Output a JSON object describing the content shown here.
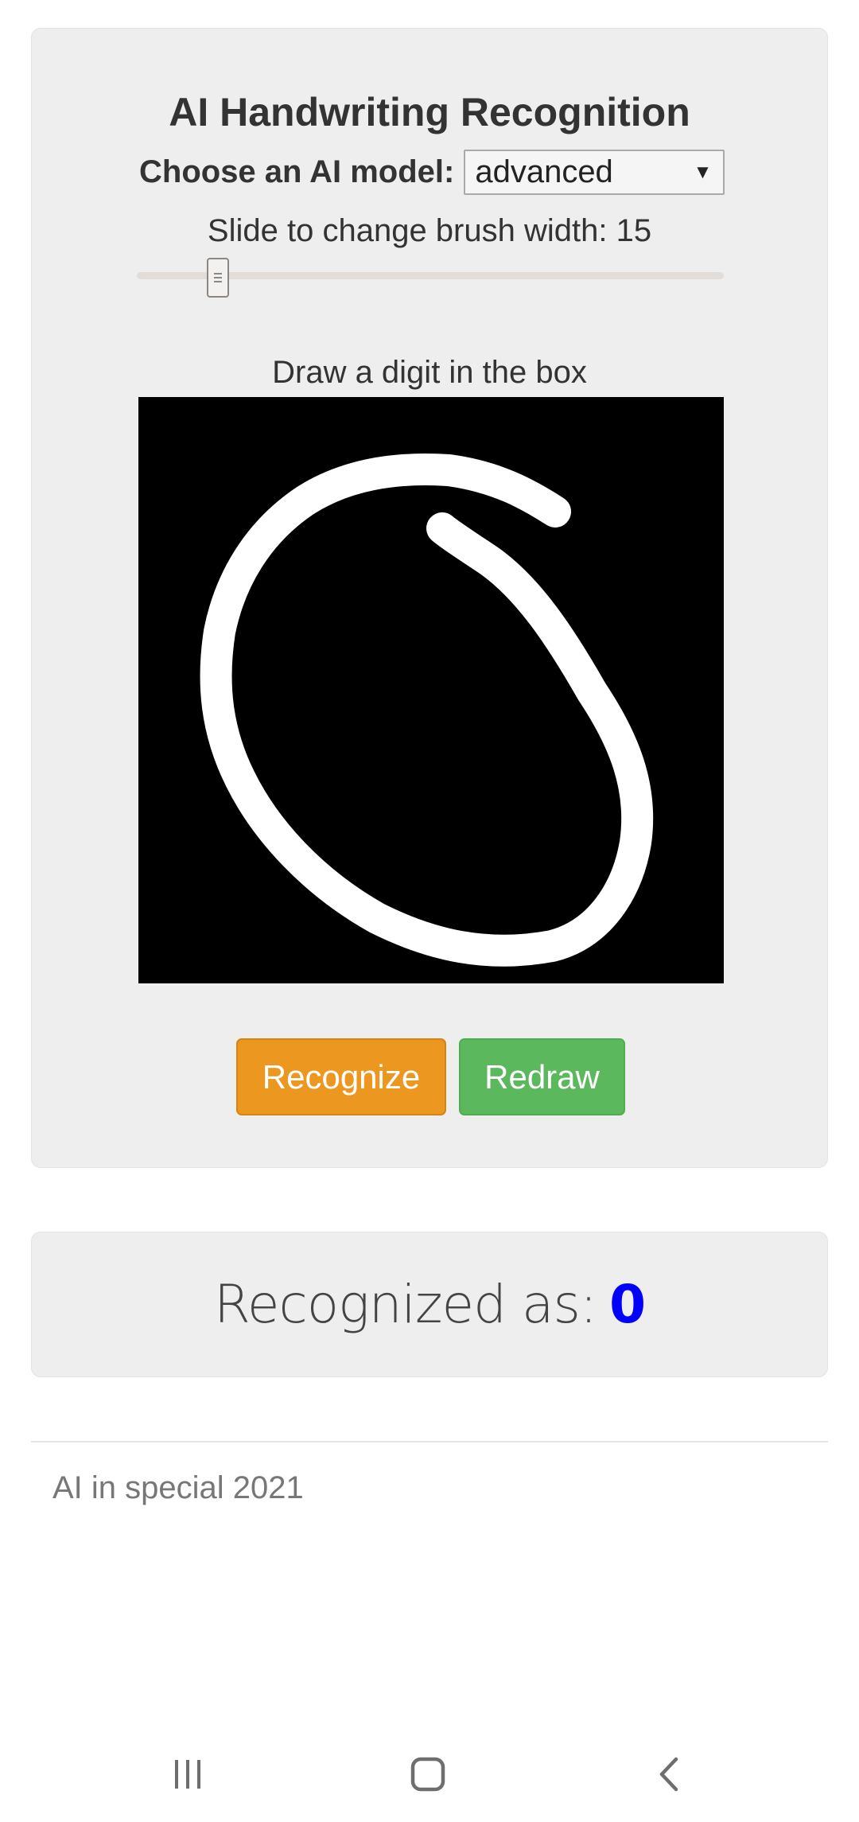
{
  "main": {
    "title": "AI Handwriting Recognition",
    "model_label": "Choose an AI model:",
    "model_selected": "advanced",
    "brush_label_prefix": "Slide to change brush width: ",
    "brush_width": "15",
    "draw_label": "Draw a digit in the box",
    "recognize_label": "Recognize",
    "redraw_label": "Redraw"
  },
  "result": {
    "label": "Recognized as:",
    "value": "0"
  },
  "footer": {
    "text": "AI in special 2021"
  },
  "colors": {
    "recognize": "#ec971f",
    "redraw": "#5cb85c",
    "result_value": "#0000ff",
    "canvas_bg": "#000000",
    "stroke": "#ffffff"
  },
  "icons": {
    "select_arrow": "dropdown-arrow-icon",
    "nav_recent": "recent-apps-icon",
    "nav_home": "home-icon",
    "nav_back": "back-icon"
  }
}
